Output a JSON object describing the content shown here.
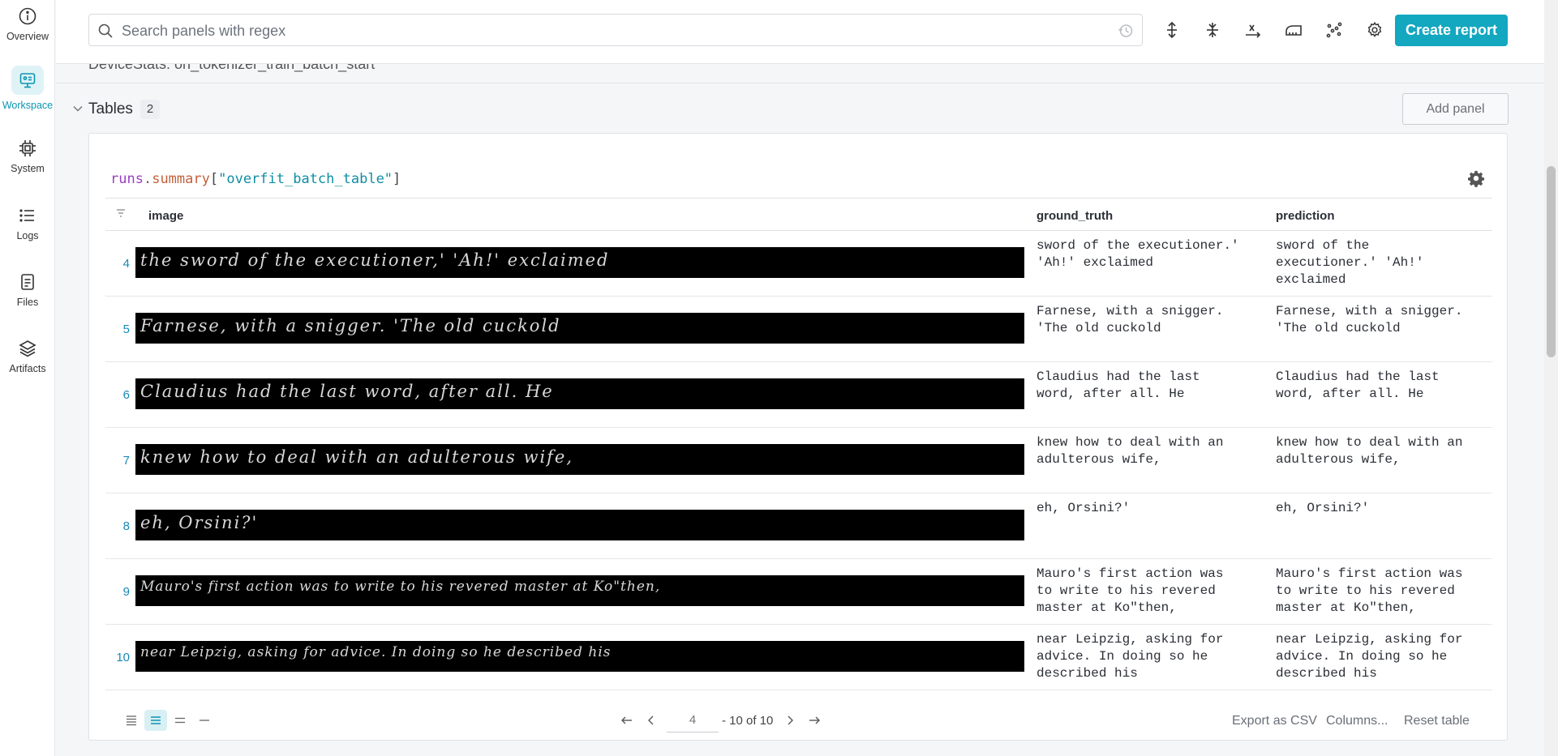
{
  "nav": {
    "items": [
      {
        "label": "Overview",
        "icon": "info-icon"
      },
      {
        "label": "Workspace",
        "icon": "workspace-icon",
        "active": true
      },
      {
        "label": "System",
        "icon": "chip-icon"
      },
      {
        "label": "Logs",
        "icon": "list-icon"
      },
      {
        "label": "Files",
        "icon": "file-icon"
      },
      {
        "label": "Artifacts",
        "icon": "layers-icon"
      }
    ]
  },
  "toolbar": {
    "search_placeholder": "Search panels with regex",
    "create_report": "Create report"
  },
  "section": {
    "clipped_title": "DeviceStats: on_tokenizer_train_batch_start",
    "title": "Tables",
    "count": "2",
    "add_panel": "Add panel"
  },
  "panel": {
    "query_runs": "runs",
    "query_dot": ".",
    "query_summary": "summary",
    "query_open": "[",
    "query_key": "\"overfit_batch_table\"",
    "query_close": "]",
    "columns": [
      "image",
      "ground_truth",
      "prediction"
    ],
    "rows": [
      {
        "idx": "4",
        "img": "the sword  of  the  executioner,' 'Ah!' exclaimed",
        "gt": "sword of the executioner.'\n'Ah!' exclaimed",
        "pred": "sword of the\nexecutioner.' 'Ah!'\nexclaimed"
      },
      {
        "idx": "5",
        "img": "Farnese, with  a  snigger. 'The  old  cuckold",
        "gt": "Farnese, with a snigger.\n'The old cuckold",
        "pred": "Farnese, with a snigger.\n'The old cuckold"
      },
      {
        "idx": "6",
        "img": "Claudius   had   the last  word, after all.  He",
        "gt": "Claudius had the last\nword, after all. He",
        "pred": "Claudius had the last\nword, after all. He"
      },
      {
        "idx": "7",
        "img": "knew  how  to  deal   with  an  adulterous  wife,",
        "gt": "knew how to deal with an\nadulterous wife,",
        "pred": "knew how to deal with an\nadulterous wife,"
      },
      {
        "idx": "8",
        "img": "eh, Orsini?'",
        "gt": "eh, Orsini?'",
        "pred": "eh, Orsini?'"
      },
      {
        "idx": "9",
        "img": "Mauro's  first  action  was  to  write  to  his  revered  master  at  Ko\"then,",
        "gt": "Mauro's first action was\nto write to his revered\nmaster at Ko\"then,",
        "pred": "Mauro's first action was\nto write to his revered\nmaster at Ko\"then,"
      },
      {
        "idx": "10",
        "img": "near  Leipzig,  asking  for  advice.  In  doing  so  he  described  his",
        "gt": "near Leipzig, asking for\nadvice. In doing so he\ndescribed his",
        "pred": "near Leipzig, asking for\nadvice. In doing so he\ndescribed his"
      }
    ],
    "footer": {
      "page_value": "4",
      "range": "- 10 of 10",
      "export": "Export as CSV",
      "columns": "Columns...",
      "reset": "Reset table"
    }
  },
  "colors": {
    "accent": "#13a7c0",
    "link": "#1a88b8"
  }
}
